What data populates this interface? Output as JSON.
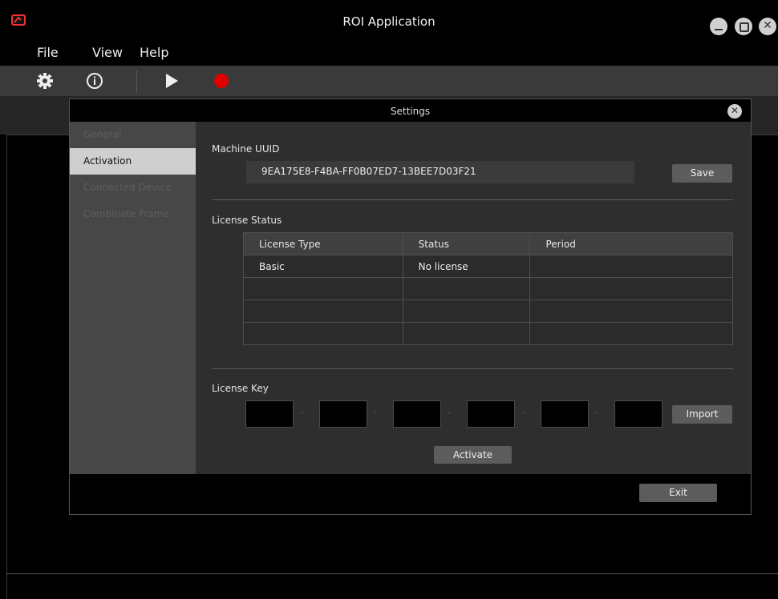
{
  "window": {
    "title": "ROI Application",
    "controls": [
      "minimize",
      "maximize",
      "close"
    ]
  },
  "menu": [
    "File",
    "View",
    "Help"
  ],
  "toolbar": {
    "icons": [
      "gear-icon",
      "info-icon",
      "play-icon",
      "record-icon"
    ],
    "record_color": "#e00000"
  },
  "dialog": {
    "title": "Settings",
    "sidebar": {
      "items": [
        {
          "label": "General"
        },
        {
          "label": "Activation"
        },
        {
          "label": "Connected Device"
        },
        {
          "label": "Combinate Frame"
        }
      ],
      "active": "Activation"
    },
    "machine_uuid": {
      "label": "Machine UUID",
      "value": "9EA175E8-F4BA-FF0B07ED7-13BEE7D03F21",
      "save_label": "Save"
    },
    "license_status": {
      "label": "License Status",
      "columns": [
        "License Type",
        "Status",
        "Period"
      ],
      "rows": [
        [
          "Basic",
          "No license",
          ""
        ],
        [
          "",
          "",
          ""
        ],
        [
          "",
          "",
          ""
        ],
        [
          "",
          "",
          ""
        ]
      ]
    },
    "license_key": {
      "label": "License Key",
      "separator": "-",
      "import_label": "Import",
      "activate_label": "Activate"
    },
    "exit_label": "Exit"
  }
}
